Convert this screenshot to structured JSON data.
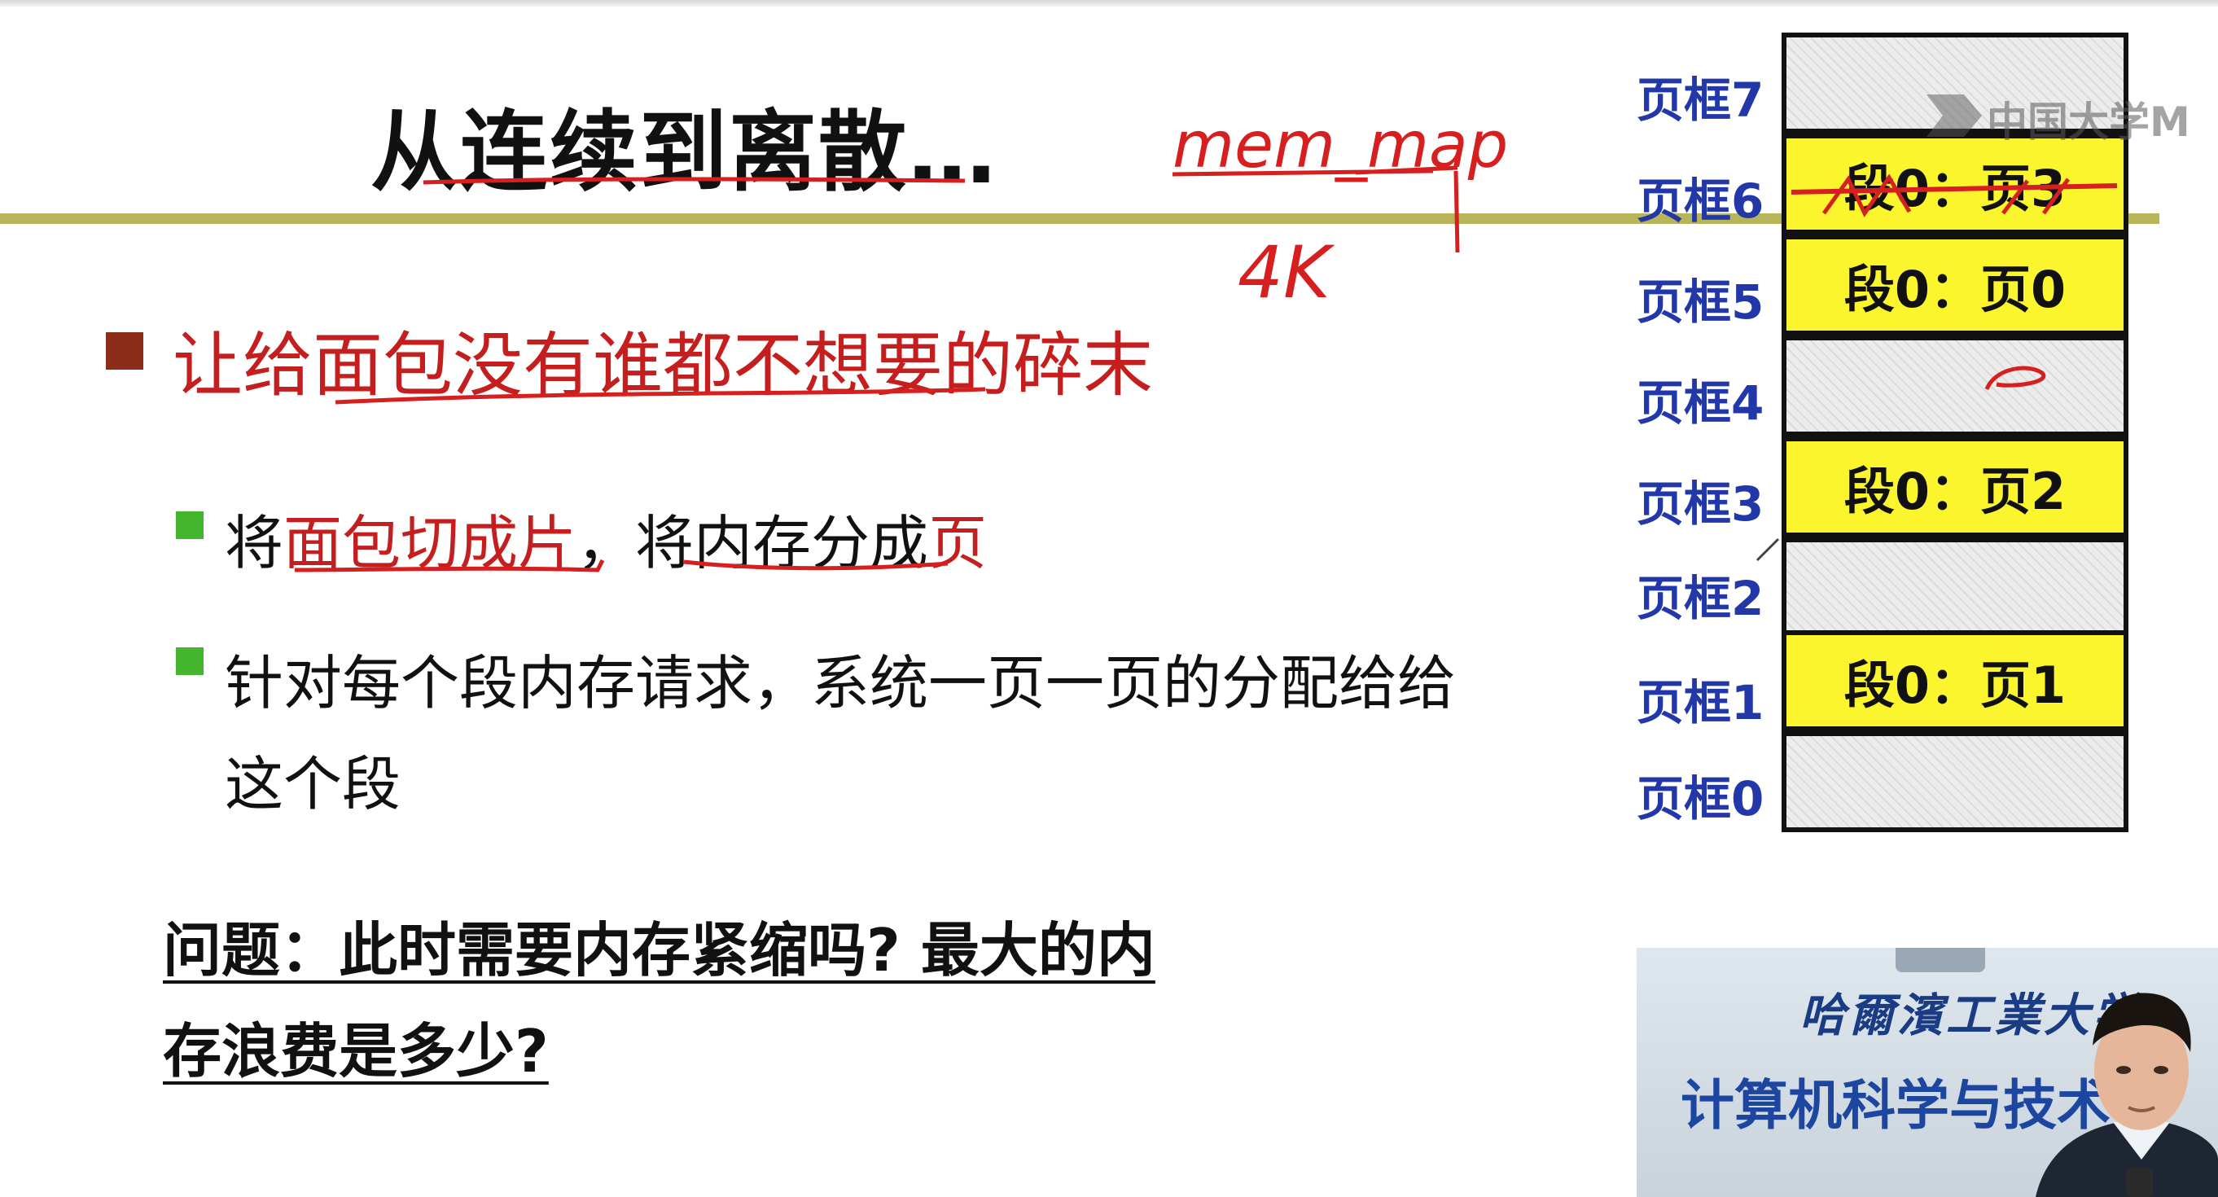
{
  "slide": {
    "title": "从连续到离散…",
    "bullet_main": "让给面包没有谁都不想要的碎末",
    "sub1": {
      "part1": "将",
      "part2": "面包切成片",
      "part3": "，将内存分成",
      "part4": "页"
    },
    "sub2": {
      "line1": "针对每个段内存请求，系统一页一页的分配给给",
      "line2": "这个段"
    },
    "question": {
      "line1": "问题：此时需要内存紧缩吗? 最大的内",
      "line2": "存浪费是多少?"
    }
  },
  "frames": [
    {
      "label": "页框7",
      "content": ""
    },
    {
      "label": "页框6",
      "content": "段0：页3"
    },
    {
      "label": "页框5",
      "content": "段0：页0"
    },
    {
      "label": "页框4",
      "content": ""
    },
    {
      "label": "页框3",
      "content": "段0：页2"
    },
    {
      "label": "页框2",
      "content": ""
    },
    {
      "label": "页框1",
      "content": "段0：页1"
    },
    {
      "label": "页框0",
      "content": ""
    }
  ],
  "annotations": {
    "handwritten_1": "mem_map",
    "handwritten_2": "4K"
  },
  "watermark": "中国大学M",
  "webcam": {
    "school": "哈爾濱工業大学",
    "department": "计算机科学与技术"
  },
  "colors": {
    "title_rule": "#b7b45a",
    "accent_red": "#c41e1e",
    "frame_label_blue": "#2238a8",
    "used_frame_yellow": "#fbf52e",
    "bullet_green": "#44b62d",
    "bullet_brown": "#8b2d18"
  }
}
